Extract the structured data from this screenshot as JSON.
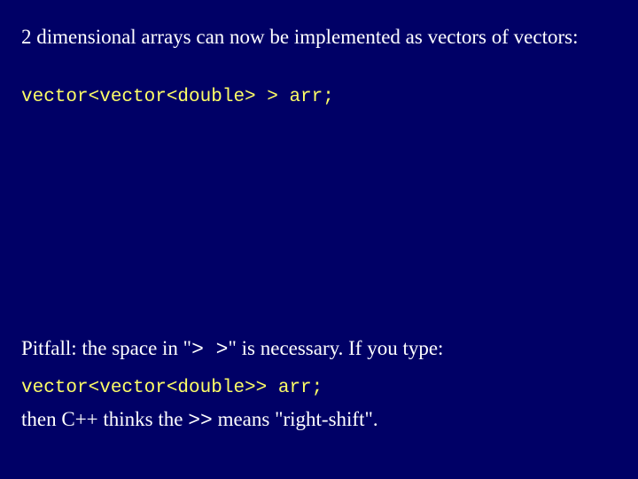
{
  "slide": {
    "line1": "2 dimensional arrays can now be implemented as vectors of vectors:",
    "code1": "vector<vector<double> > arr;",
    "pitfall_prefix": "Pitfall: the space in \"",
    "pitfall_sym": ">  >",
    "pitfall_suffix": "\" is necessary.  If you type:",
    "code2": "vector<vector<double>> arr;",
    "then_prefix": "then C++ thinks the ",
    "then_sym": ">>",
    "then_suffix": " means \"right-shift\"."
  }
}
